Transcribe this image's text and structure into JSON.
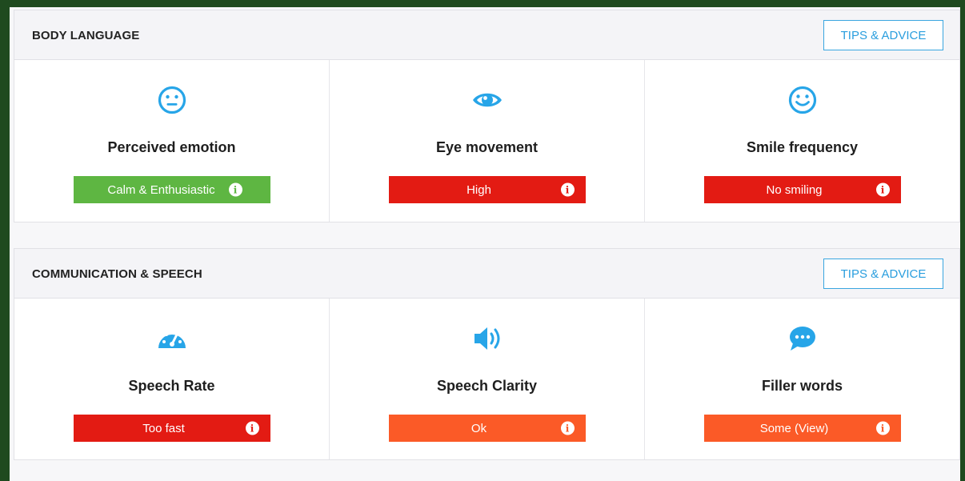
{
  "colors": {
    "accent": "#2a9ede",
    "icon": "#27a5e8",
    "green": "#5eb642",
    "red": "#e31b13",
    "orange": "#fb5a27"
  },
  "sections": [
    {
      "title": "BODY LANGUAGE",
      "tips_label": "TIPS & ADVICE",
      "cards": [
        {
          "icon": "neutral-face-icon",
          "label": "Perceived emotion",
          "status": "Calm & Enthusiastic",
          "status_color": "#5eb642"
        },
        {
          "icon": "eye-icon",
          "label": "Eye movement",
          "status": "High",
          "status_color": "#e31b13"
        },
        {
          "icon": "smile-face-icon",
          "label": "Smile frequency",
          "status": "No smiling",
          "status_color": "#e31b13"
        }
      ]
    },
    {
      "title": "COMMUNICATION & SPEECH",
      "tips_label": "TIPS & ADVICE",
      "cards": [
        {
          "icon": "speedometer-icon",
          "label": "Speech Rate",
          "status": "Too fast",
          "status_color": "#e31b13"
        },
        {
          "icon": "speaker-icon",
          "label": "Speech Clarity",
          "status": "Ok",
          "status_color": "#fb5a27"
        },
        {
          "icon": "chat-bubble-icon",
          "label": "Filler words",
          "status": "Some (View)",
          "status_color": "#fb5a27"
        }
      ]
    }
  ]
}
